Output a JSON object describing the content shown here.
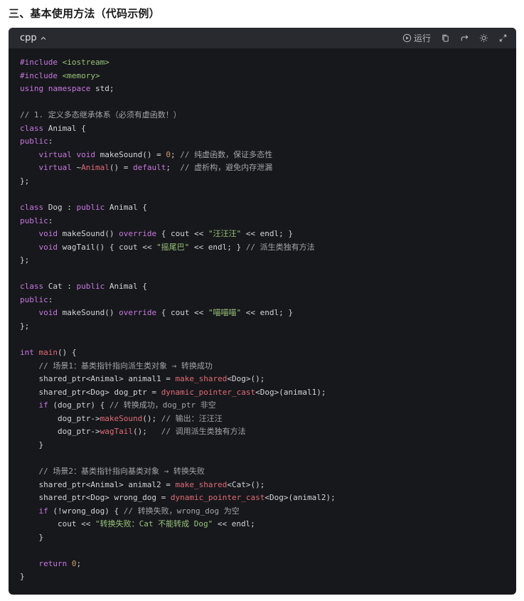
{
  "heading": "三、基本使用方法（代码示例）",
  "code_block": {
    "language": "cpp",
    "run_label": "运行",
    "icons": [
      "chevron-up-icon",
      "play-icon",
      "copy-icon",
      "redirect-icon",
      "theme-icon",
      "expand-icon"
    ],
    "lines": [
      [
        {
          "t": "#include ",
          "c": "pp"
        },
        {
          "t": "<iostream>",
          "c": "st"
        }
      ],
      [
        {
          "t": "#include ",
          "c": "pp"
        },
        {
          "t": "<memory>",
          "c": "st"
        }
      ],
      [
        {
          "t": "using namespace ",
          "c": "kw"
        },
        {
          "t": "std;",
          "c": ""
        }
      ],
      [],
      [
        {
          "t": "// 1. 定义多态继承体系（必须有虚函数！）",
          "c": "cm"
        }
      ],
      [
        {
          "t": "class ",
          "c": "kw"
        },
        {
          "t": "Animal {",
          "c": ""
        }
      ],
      [
        {
          "t": "public",
          "c": "kw"
        },
        {
          "t": ":",
          "c": ""
        }
      ],
      [
        {
          "t": "    virtual void ",
          "c": "kw"
        },
        {
          "t": "makeSound",
          "c": ""
        },
        {
          "t": "() = ",
          "c": ""
        },
        {
          "t": "0",
          "c": "nu"
        },
        {
          "t": "; ",
          "c": ""
        },
        {
          "t": "// 纯虚函数，保证多态性",
          "c": "cm"
        }
      ],
      [
        {
          "t": "    virtual ",
          "c": "kw"
        },
        {
          "t": "~",
          "c": ""
        },
        {
          "t": "Animal",
          "c": "fn"
        },
        {
          "t": "() = ",
          "c": ""
        },
        {
          "t": "default",
          "c": "kw"
        },
        {
          "t": ";  ",
          "c": ""
        },
        {
          "t": "// 虚析构，避免内存泄漏",
          "c": "cm"
        }
      ],
      [
        {
          "t": "};",
          "c": ""
        }
      ],
      [],
      [
        {
          "t": "class ",
          "c": "kw"
        },
        {
          "t": "Dog : ",
          "c": ""
        },
        {
          "t": "public ",
          "c": "kw"
        },
        {
          "t": "Animal {",
          "c": ""
        }
      ],
      [
        {
          "t": "public",
          "c": "kw"
        },
        {
          "t": ":",
          "c": ""
        }
      ],
      [
        {
          "t": "    void ",
          "c": "kw"
        },
        {
          "t": "makeSound",
          "c": ""
        },
        {
          "t": "() ",
          "c": ""
        },
        {
          "t": "override ",
          "c": "kw"
        },
        {
          "t": "{ cout << ",
          "c": ""
        },
        {
          "t": "\"汪汪汪\"",
          "c": "st"
        },
        {
          "t": " << endl; }",
          "c": ""
        }
      ],
      [
        {
          "t": "    void ",
          "c": "kw"
        },
        {
          "t": "wagTail",
          "c": ""
        },
        {
          "t": "() { cout << ",
          "c": ""
        },
        {
          "t": "\"摇尾巴\"",
          "c": "st"
        },
        {
          "t": " << endl; } ",
          "c": ""
        },
        {
          "t": "// 派生类独有方法",
          "c": "cm"
        }
      ],
      [
        {
          "t": "};",
          "c": ""
        }
      ],
      [],
      [
        {
          "t": "class ",
          "c": "kw"
        },
        {
          "t": "Cat : ",
          "c": ""
        },
        {
          "t": "public ",
          "c": "kw"
        },
        {
          "t": "Animal {",
          "c": ""
        }
      ],
      [
        {
          "t": "public",
          "c": "kw"
        },
        {
          "t": ":",
          "c": ""
        }
      ],
      [
        {
          "t": "    void ",
          "c": "kw"
        },
        {
          "t": "makeSound",
          "c": ""
        },
        {
          "t": "() ",
          "c": ""
        },
        {
          "t": "override ",
          "c": "kw"
        },
        {
          "t": "{ cout << ",
          "c": ""
        },
        {
          "t": "\"喵喵喵\"",
          "c": "st"
        },
        {
          "t": " << endl; }",
          "c": ""
        }
      ],
      [
        {
          "t": "};",
          "c": ""
        }
      ],
      [],
      [
        {
          "t": "int ",
          "c": "kw"
        },
        {
          "t": "main",
          "c": "fn"
        },
        {
          "t": "() {",
          "c": ""
        }
      ],
      [
        {
          "t": "    // 场景1：基类指针指向派生类对象 → 转换成功",
          "c": "cm"
        }
      ],
      [
        {
          "t": "    shared_ptr<Animal> animal1 = ",
          "c": ""
        },
        {
          "t": "make_shared",
          "c": "fn"
        },
        {
          "t": "<Dog>();",
          "c": ""
        }
      ],
      [
        {
          "t": "    shared_ptr<Dog> dog_ptr = ",
          "c": ""
        },
        {
          "t": "dynamic_pointer_cast",
          "c": "fn"
        },
        {
          "t": "<Dog>(animal1);",
          "c": ""
        }
      ],
      [
        {
          "t": "    if ",
          "c": "kw"
        },
        {
          "t": "(dog_ptr) { ",
          "c": ""
        },
        {
          "t": "// 转换成功，dog_ptr 非空",
          "c": "cm"
        }
      ],
      [
        {
          "t": "        dog_ptr->",
          "c": ""
        },
        {
          "t": "makeSound",
          "c": "fn"
        },
        {
          "t": "(); ",
          "c": ""
        },
        {
          "t": "// 输出：汪汪汪",
          "c": "cm"
        }
      ],
      [
        {
          "t": "        dog_ptr->",
          "c": ""
        },
        {
          "t": "wagTail",
          "c": "fn"
        },
        {
          "t": "();   ",
          "c": ""
        },
        {
          "t": "// 调用派生类独有方法",
          "c": "cm"
        }
      ],
      [
        {
          "t": "    }",
          "c": ""
        }
      ],
      [],
      [
        {
          "t": "    // 场景2：基类指针指向基类对象 → 转换失败",
          "c": "cm"
        }
      ],
      [
        {
          "t": "    shared_ptr<Animal> animal2 = ",
          "c": ""
        },
        {
          "t": "make_shared",
          "c": "fn"
        },
        {
          "t": "<Cat>();",
          "c": ""
        }
      ],
      [
        {
          "t": "    shared_ptr<Dog> wrong_dog = ",
          "c": ""
        },
        {
          "t": "dynamic_pointer_cast",
          "c": "fn"
        },
        {
          "t": "<Dog>(animal2);",
          "c": ""
        }
      ],
      [
        {
          "t": "    if ",
          "c": "kw"
        },
        {
          "t": "(!wrong_dog) { ",
          "c": ""
        },
        {
          "t": "// 转换失败，wrong_dog 为空",
          "c": "cm"
        }
      ],
      [
        {
          "t": "        cout << ",
          "c": ""
        },
        {
          "t": "\"转换失败：Cat 不能转成 Dog\"",
          "c": "st"
        },
        {
          "t": " << endl;",
          "c": ""
        }
      ],
      [
        {
          "t": "    }",
          "c": ""
        }
      ],
      [],
      [
        {
          "t": "    return ",
          "c": "kw"
        },
        {
          "t": "0",
          "c": "nu"
        },
        {
          "t": ";",
          "c": ""
        }
      ],
      [
        {
          "t": "}",
          "c": ""
        }
      ]
    ]
  }
}
